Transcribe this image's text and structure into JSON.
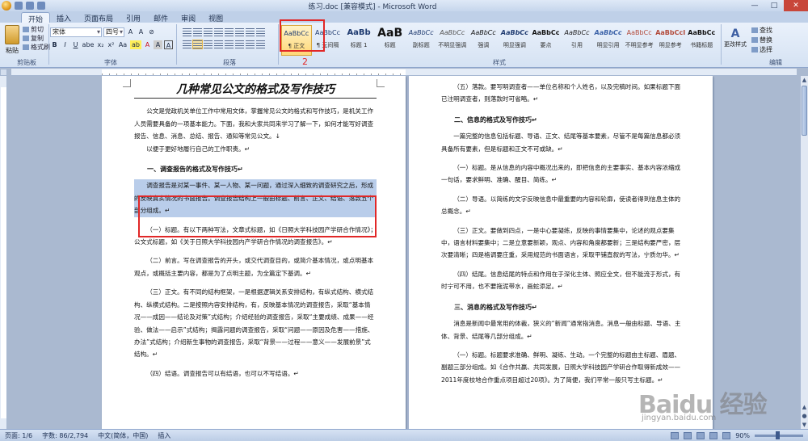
{
  "window": {
    "title": "练习.doc [兼容模式] - Microsoft Word",
    "controls": [
      "—",
      "□",
      "✕"
    ]
  },
  "tabs": [
    "开始",
    "插入",
    "页面布局",
    "引用",
    "邮件",
    "审阅",
    "视图"
  ],
  "clipboard": {
    "paste": "粘贴",
    "cut": "剪切",
    "copy": "复制",
    "format_painter": "格式刷",
    "label": "剪贴板"
  },
  "font": {
    "name": "宋体",
    "size": "四号",
    "label": "字体",
    "row1": [
      "A",
      "A",
      "Aa",
      "⊘",
      "變",
      "A"
    ],
    "row2": [
      "B",
      "I",
      "U",
      "abe",
      "x₂",
      "x²",
      "Aa",
      "ab",
      "A",
      "A",
      "A"
    ]
  },
  "paragraph": {
    "label": "段落"
  },
  "styles": {
    "label": "样式",
    "tiles": [
      {
        "sample": "AaBbCc",
        "name": "¶ 正文"
      },
      {
        "sample": "AaBbCc",
        "name": "¶ 无间隔"
      },
      {
        "sample": "AaBb",
        "name": "标题 1"
      },
      {
        "sample": "AaB",
        "name": "标题"
      },
      {
        "sample": "AaBbCc",
        "name": "副标题"
      },
      {
        "sample": "AaBbCc",
        "name": "不明显强调"
      },
      {
        "sample": "AaBbCc",
        "name": "强调"
      },
      {
        "sample": "AaBbCc",
        "name": "明显强调"
      },
      {
        "sample": "AaBbCc",
        "name": "要点"
      },
      {
        "sample": "AaBbCc",
        "name": "引用"
      },
      {
        "sample": "AaBbCc",
        "name": "明显引用"
      },
      {
        "sample": "AaBbCc",
        "name": "不明显参考"
      },
      {
        "sample": "AaBbCcI",
        "name": "明显参考"
      },
      {
        "sample": "AaBbCc",
        "name": "书籍标题"
      }
    ]
  },
  "callout": {
    "number": "2"
  },
  "change_styles": {
    "label": "更改样式"
  },
  "editing": {
    "find": "查找",
    "replace": "替换",
    "select": "选择",
    "label": "编辑"
  },
  "page1": {
    "title": "几种常见公文的格式及写作技巧",
    "intro": "公文是党政机关单位工作中常用文体，掌握常见公文的格式和写作技巧，是机关工作人员需要具备的一项基本能力。下面，我和大家共同来学习了解一下，如何才能写好调查报告、信息、消息、总结、报告、通知等常见公文。↓",
    "intro2": "以便于更好地履行自己的工作职责。↵",
    "h1": "一、调查报告的格式及写作技巧↵",
    "selected": "调查报告是对某一事件、某一人物、某一问题，通过深入细致的调查研究之后，形成的反映真实情况的书面报告。调查报告结构上一般由标题、前言、正文、结语、落款五个部分组成。↵",
    "p_title": "（一）标题。有以下两种写法，文章式标题，如《日照大学科技园产学研合作情况》；公文式标题，如《关于日照大学科技园内产学研合作情况的调查报告》。↵",
    "p_foreword": "（二）前言。写在调查报告的开头，或交代调查目的，或简介基本情况，或点明基本观点，或概括主要内容，都是为了点明主题，为全篇定下基调。↵",
    "p_body": "（三）正文。有不同的结构框架，一是根据逻辑关系安排结构，有纵式结构、横式结构、纵横式结构。二是按照内容安排结构，有，反映基本情况的调查报告，采取“基本情况——成因——结论及对策”式结构；介绍经验的调查报告，采取“主要成绩、成果——经验、做法——启示”式结构；揭露问题的调查报告，采取“问题——原因及危害——措施、办法”式结构；介绍新生事物的调查报告，采取“背景——过程——意义——发展前景”式结构。↵",
    "p_end": "（四）结语。调查报告可以有结语，也可以不写结语。↵"
  },
  "page2": {
    "p_sign": "（五）落款。要写明调查者——单位名称和个人姓名，以及完稿时间。如果标题下面已注明调查者，则落款时可省略。↵",
    "h2": "二、信息的格式及写作技巧↵",
    "info_intro": "一篇完整的信息包括标题、导语、正文、结尾等基本要素，尽管不是每篇信息都必须具备所有要素，但是标题和正文不可或缺。↵",
    "info_title": "（一）标题。是从信息的内容中概况出来的，即把信息的主要事实、基本内容浓缩成一句话，要求鲜明、准确、醒目、简练。↵",
    "info_lead": "（二）导语。以简练的文字反映信息中最重要的内容和轮廓，使读者得到信息主体的总概念。↵",
    "info_body": "（三）正文。要做到四点，一是中心要凝练，反映的事情要集中，论述的观点要集中，语言材料要集中；二是立意要新颖，观点、内容和角度都要新；三是结构要严密，层次要清晰；四是格调要庄重，采用规范的书面语言，采取平铺直叙的写法，宁质勿华。↵",
    "info_end": "（四）结尾。信息结尾的特点和作用在于深化主体、照应全文，但不能流于形式，有时宁可不用，也不要拖泥带水，画蛇添足。↵",
    "h3": "三、消息的格式及写作技巧↵",
    "news_intro": "消息是新闻中最常用的体裁，狭义的“新闻”通常指消息。消息一般由标题、导语、主体、背景、结尾等几部分组成。↵",
    "news_title": "（一）标题。标题要求准确、鲜明、凝练、生动。一个完整的标题由主标题、眉题、副题三部分组成。如《合作共赢、共同发展，日照大学科技园产学研合作取得新成效——2011年度校地合作重点项目超过20项》。为了简便，我们平常一般只写主标题。↵"
  },
  "status": {
    "page": "页面: 1/6",
    "words": "字数: 86/2,794",
    "lang": "中文(简体，中国)",
    "mode": "插入",
    "zoom": "90%"
  },
  "watermark": {
    "main": "Baidu 经验",
    "sub": "jingyan.baidu.com"
  }
}
